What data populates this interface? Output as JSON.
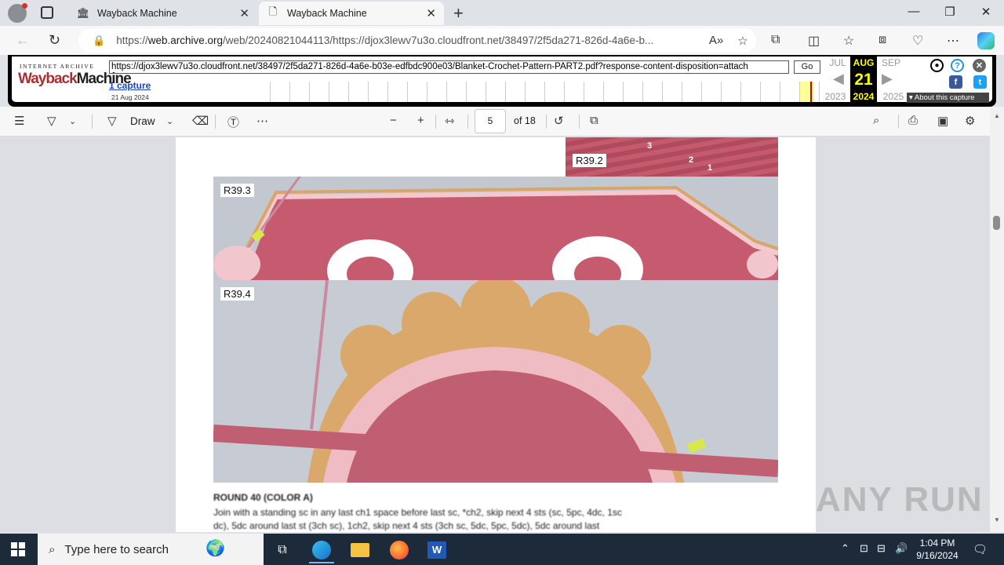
{
  "browser": {
    "tabs": [
      {
        "title": "Wayback Machine",
        "active": false
      },
      {
        "title": "Wayback Machine",
        "active": true
      }
    ],
    "address": {
      "scheme": "https://",
      "domain": "web.archive.org",
      "path": "/web/20240821044113/https://djox3lewv7u3o.cloudfront.net/38497/2f5da271-826d-4a6e-b..."
    }
  },
  "wayback": {
    "ia_text": "INTERNET ARCHIVE",
    "logo_text_a": "Wayback",
    "logo_text_b": "Machine",
    "url_value": "https://djox3lewv7u3o.cloudfront.net/38497/2f5da271-826d-4a6e-b03e-edfbdc900e03/Blanket-Crochet-Pattern-PART2.pdf?response-content-disposition=attach",
    "go_label": "Go",
    "captures_link": "1 capture",
    "capture_date": "21 Aug 2024",
    "prev_month": "JUL",
    "cur_month": "AUG",
    "next_month": "SEP",
    "cur_day": "21",
    "prev_year": "2023",
    "cur_year": "2024",
    "next_year": "2025",
    "about_label": "About this capture"
  },
  "pdf_toolbar": {
    "draw_label": "Draw",
    "page_current": "5",
    "page_total": "of 18"
  },
  "document": {
    "photos": [
      {
        "label": "R39.2"
      },
      {
        "label": "R39.3"
      },
      {
        "label": "R39.4"
      }
    ],
    "photo_numbers": [
      "3",
      "2",
      "1"
    ],
    "blurred_heading": "ROUND 40 (COLOR A)",
    "blurred_line1": "Join with a standing sc in any last ch1 space before last sc, *ch2, skip next 4 sts (sc, 5pc, 4dc, 1sc",
    "blurred_line2": "dc), 5dc around last st (3ch sc), 1ch2, skip next 4 sts (3ch sc, 5dc, 5pc, 5dc), 5dc around last"
  },
  "watermark": "ANY RUN",
  "taskbar": {
    "search_placeholder": "Type here to search",
    "time": "1:04 PM",
    "date": "9/16/2024"
  }
}
